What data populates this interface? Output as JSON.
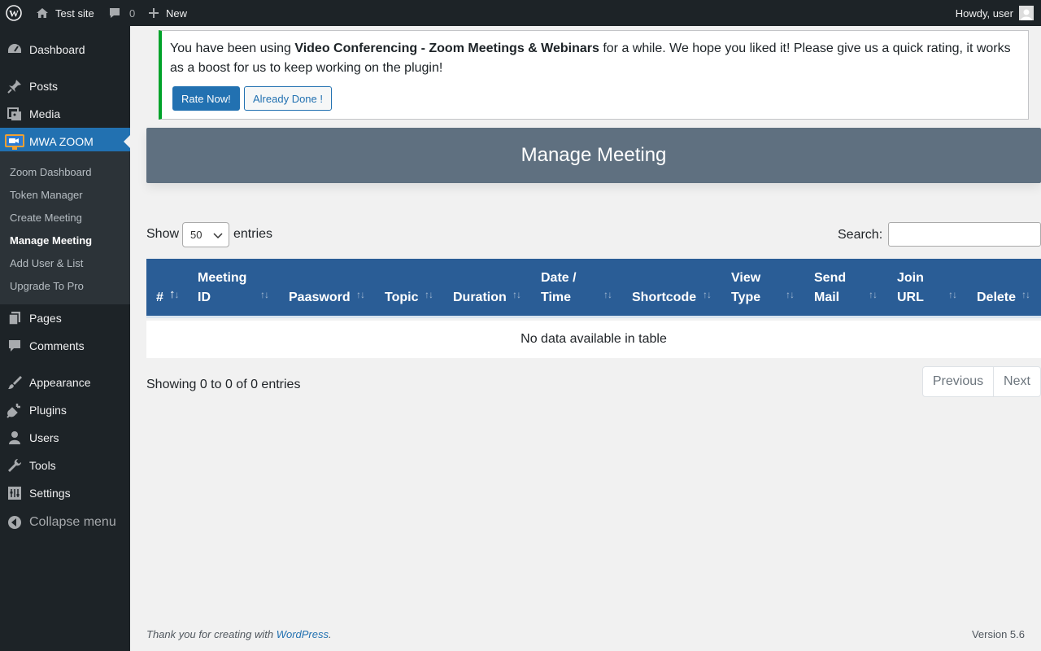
{
  "adminbar": {
    "site_name": "Test site",
    "comments_count": "0",
    "new_label": "New",
    "greeting": "Howdy, user",
    "icons": [
      "wordpress-logo-icon",
      "home-icon",
      "comment-bubble-icon",
      "plus-icon",
      "avatar"
    ]
  },
  "sidebar": {
    "items": [
      {
        "label": "Dashboard",
        "icon": "dashboard-icon"
      },
      {
        "label": "Posts",
        "icon": "pin-icon"
      },
      {
        "label": "Media",
        "icon": "media-icon"
      },
      {
        "label": "MWA ZOOM",
        "icon": "zoom-camera-icon"
      },
      {
        "label": "Pages",
        "icon": "pages-icon"
      },
      {
        "label": "Comments",
        "icon": "comment-icon"
      },
      {
        "label": "Appearance",
        "icon": "brush-icon"
      },
      {
        "label": "Plugins",
        "icon": "plug-icon"
      },
      {
        "label": "Users",
        "icon": "user-icon"
      },
      {
        "label": "Tools",
        "icon": "wrench-icon"
      },
      {
        "label": "Settings",
        "icon": "settings-sliders-icon"
      }
    ],
    "submenu": [
      "Zoom Dashboard",
      "Token Manager",
      "Create Meeting",
      "Manage Meeting",
      "Add User & List",
      "Upgrade To Pro"
    ],
    "current_submenu": "Manage Meeting",
    "collapse_label": "Collapse menu"
  },
  "notice": {
    "text_before": "You have been using ",
    "plugin_name": "Video Conferencing - Zoom Meetings & Webinars",
    "text_after": " for a while. We hope you liked it! Please give us a quick rating, it works as a boost for us to keep working on the plugin!",
    "rate_label": "Rate Now!",
    "done_label": "Already Done !"
  },
  "page": {
    "title": "Manage Meeting"
  },
  "table_controls": {
    "show_label": "Show",
    "entries_label": "entries",
    "page_length": "50",
    "search_label": "Search:",
    "search_value": ""
  },
  "table": {
    "columns": [
      {
        "line1": "",
        "line2": "#"
      },
      {
        "line1": "Meeting",
        "line2": "ID"
      },
      {
        "line1": "",
        "line2": "Paasword"
      },
      {
        "line1": "",
        "line2": "Topic"
      },
      {
        "line1": "",
        "line2": "Duration"
      },
      {
        "line1": "Date /",
        "line2": "Time"
      },
      {
        "line1": "",
        "line2": "Shortcode"
      },
      {
        "line1": "View",
        "line2": "Type"
      },
      {
        "line1": "Send",
        "line2": "Mail"
      },
      {
        "line1": "Join",
        "line2": "URL"
      },
      {
        "line1": "",
        "line2": "Delete"
      }
    ],
    "sort_glyph": "↑↓",
    "empty_message": "No data available in table",
    "info": "Showing 0 to 0 of 0 entries",
    "prev_label": "Previous",
    "next_label": "Next"
  },
  "footer": {
    "thanks_prefix": "Thank you for creating with ",
    "link_text": "WordPress",
    "thanks_suffix": ".",
    "version": "Version 5.6"
  },
  "colors": {
    "adminbar_bg": "#1d2327",
    "accent": "#2271b1",
    "notice_border": "#00a32a",
    "header_box": "#5f7080",
    "table_head": "#2a5d96"
  }
}
